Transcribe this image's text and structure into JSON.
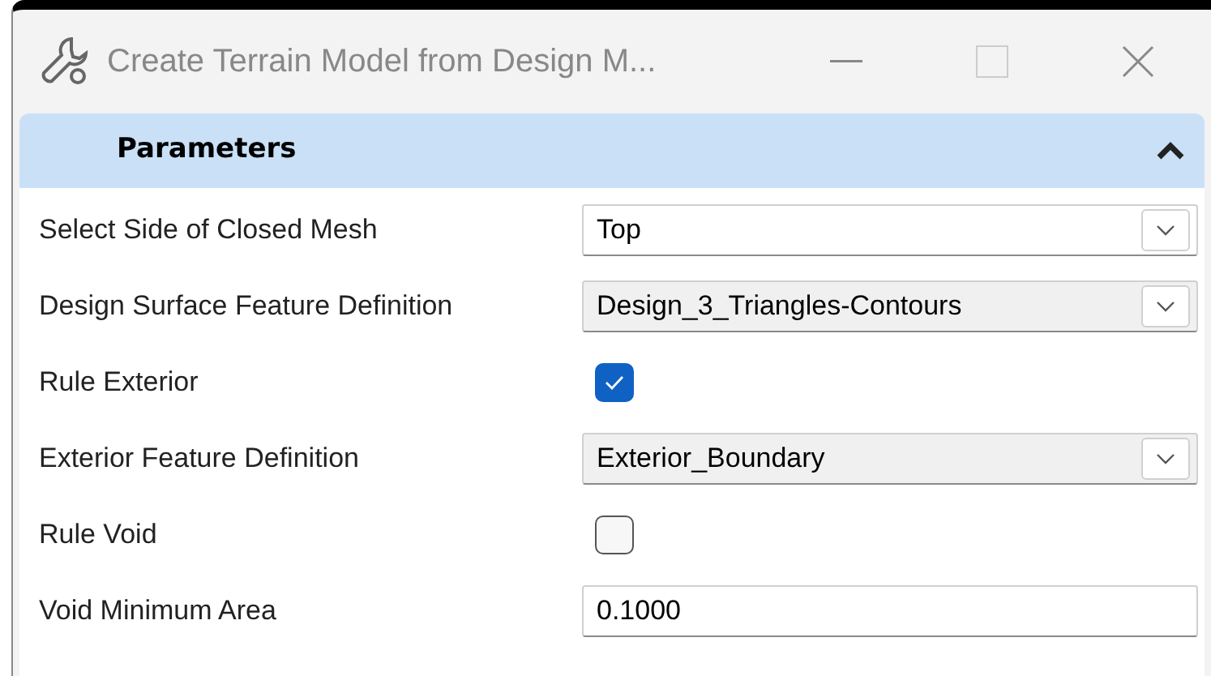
{
  "window": {
    "title": "Create Terrain Model from Design M..."
  },
  "section": {
    "title": "Parameters",
    "expanded": true
  },
  "rows": [
    {
      "kind": "dropdown",
      "label": "Select Side of Closed Mesh",
      "value": "Top",
      "enabled": true
    },
    {
      "kind": "dropdown",
      "label": "Design Surface Feature Definition",
      "value": "Design_3_Triangles-Contours",
      "enabled": false
    },
    {
      "kind": "checkbox",
      "label": "Rule Exterior",
      "checked": true
    },
    {
      "kind": "dropdown",
      "label": "Exterior Feature Definition",
      "value": "Exterior_Boundary",
      "enabled": false
    },
    {
      "kind": "checkbox",
      "label": "Rule Void",
      "checked": false
    },
    {
      "kind": "text",
      "label": "Void Minimum Area",
      "value": "0.1000"
    }
  ]
}
